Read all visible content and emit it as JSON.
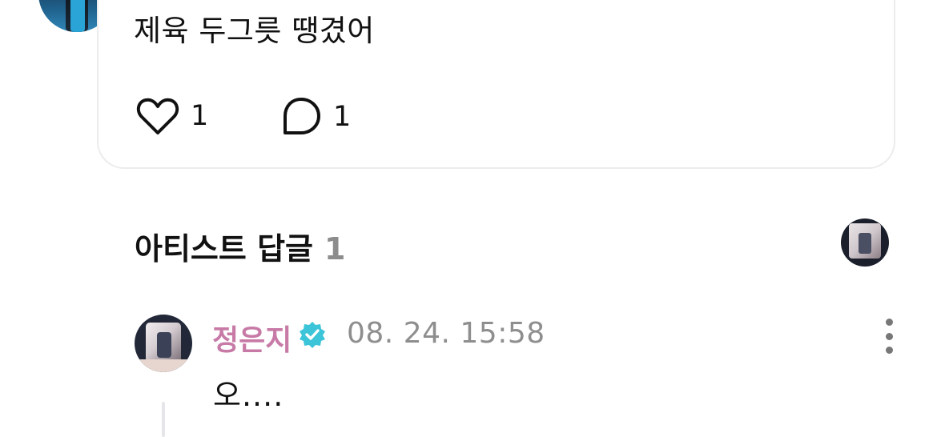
{
  "post": {
    "text": "제육 두그릇 땡겼어",
    "like_count": "1",
    "comment_count": "1",
    "icons": {
      "like": "heart-icon",
      "comment": "speech-bubble-icon"
    }
  },
  "artist_replies": {
    "title": "아티스트 답글",
    "count": "1"
  },
  "reply": {
    "author": "정은지",
    "timestamp": "08. 24. 15:58",
    "text": "오....",
    "author_color": "#c77aa6",
    "verified_color": "#3cc4d8",
    "icons": {
      "verified": "verified-badge-icon",
      "more": "more-vertical-icon"
    }
  }
}
